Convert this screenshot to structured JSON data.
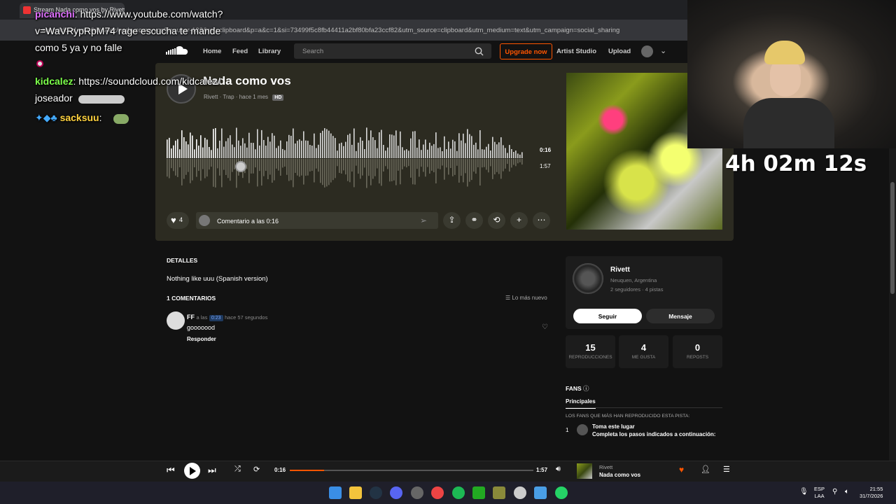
{
  "browser": {
    "tab_title": "Stream Nada como vos by Rivett",
    "url": "soundcloud.com/kidcalez/nada-como-vos?in=user-123&ref=clipboard&p=a&c=1&si=73499f5c8fb44411a2bf80bfa23ccf82&utm_source=clipboard&utm_medium=text&utm_campaign=social_sharing"
  },
  "header": {
    "nav": [
      "Home",
      "Feed",
      "Library"
    ],
    "search_placeholder": "Search",
    "upgrade_label": "Upgrade now",
    "artist_studio": "Artist Studio",
    "upload": "Upload"
  },
  "track": {
    "title": "Nada como vos",
    "artist": "Rivett",
    "genre": "Trap",
    "posted": "hace 1 mes",
    "quality": "HD",
    "time_current": "0:16",
    "time_total": "1:57",
    "likes": "4",
    "comment_placeholder": "Comentario a las 0:16",
    "progress_fraction": 0.14
  },
  "details": {
    "heading": "DETALLES",
    "description": "Nothing like uuu (Spanish version)"
  },
  "comments": {
    "heading": "1 COMENTARIOS",
    "sort_label": "Lo más nuevo",
    "items": [
      {
        "user": "FF",
        "at_label": "a las",
        "timestamp": "0:23",
        "ago": "hace 57 segundos",
        "text": "gooooood",
        "reply_label": "Responder"
      }
    ]
  },
  "artist_card": {
    "name": "Rivett",
    "location": "Neuquen, Argentina",
    "stats_line": "2 seguidores · 4 pistas",
    "follow_label": "Seguir",
    "message_label": "Mensaje"
  },
  "stats": [
    {
      "value": "15",
      "label": "REPRODUCCIONES"
    },
    {
      "value": "4",
      "label": "ME GUSTA"
    },
    {
      "value": "0",
      "label": "REPOSTS"
    }
  ],
  "fans": {
    "heading": "FANS",
    "tab": "Principales",
    "description": "LOS FANS QUE MÁS HAN REPRODUCIDO ESTA PISTA:",
    "rank": "1",
    "tooltip_title": "Toma este lugar",
    "tooltip_text": "Completa los pasos indicados a continuación:"
  },
  "chat": [
    {
      "user": "picanchi",
      "message": "https://www.youtube.com/watch?"
    },
    {
      "user": "",
      "message": "v=WaVRypRpM74 rage escucha te mande"
    },
    {
      "user": "",
      "message": "como 5 ya y no falle"
    },
    {
      "user": "kidcalez",
      "message": "https://soundcloud.com/kidcalez/"
    },
    {
      "user": "",
      "message": "joseador"
    },
    {
      "user": "sacksuu",
      "message": ""
    }
  ],
  "stream_timer": "4h 02m 12s",
  "player": {
    "time_current": "0:16",
    "time_total": "1:57",
    "artist": "Rivett",
    "title": "Nada como vos"
  },
  "taskbar": {
    "lang_top": "ESP",
    "lang_bottom": "LAA",
    "time": "21:55",
    "date": "31/7/2026"
  },
  "colors": {
    "accent": "#ff5500",
    "hero_bg": "#2c2b21"
  }
}
